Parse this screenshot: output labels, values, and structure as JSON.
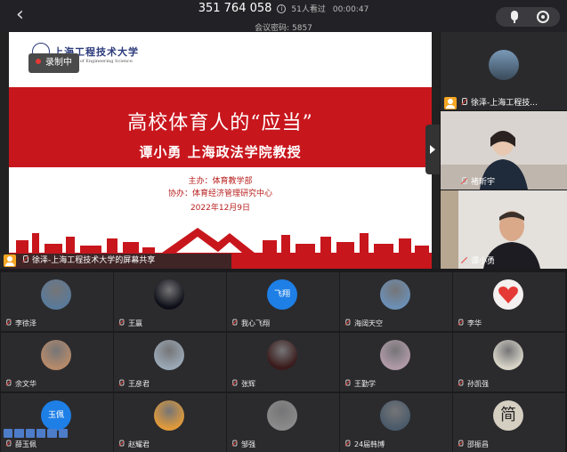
{
  "header": {
    "meeting_id": "351 764 058",
    "participants": "51人看过",
    "elapsed": "00:00:47",
    "password": "会议密码: 5857"
  },
  "share": {
    "recording_label": "录制中",
    "logo_zh": "上海工程技术大学",
    "logo_en": "University of Engineering Science",
    "title": "高校体育人的“应当”",
    "subtitle": "谭小勇  上海政法学院教授",
    "host": "主办：体育教学部",
    "co_host": "协办：体育经济管理研究中心",
    "date": "2022年12月9日",
    "sharer_label": "徐泽-上海工程技术大学的屏幕共享"
  },
  "side_videos": [
    {
      "name": "徐泽-上海工程技..."
    },
    {
      "name": "褚昕宇"
    },
    {
      "name": "谭小勇"
    }
  ],
  "grid": [
    {
      "name": "李徐泽",
      "avatar": "photo-figure",
      "color": "#5a7a9a"
    },
    {
      "name": "王赢",
      "avatar": "photo-dark",
      "color": "#0e0e18"
    },
    {
      "name": "我心飞翔",
      "avatar": "text",
      "text": "飞翔",
      "color": "#1e7fe6"
    },
    {
      "name": "海阔天空",
      "avatar": "photo-person",
      "color": "#6b8fb5"
    },
    {
      "name": "李华",
      "avatar": "heart",
      "color": "#f3f0ef"
    },
    {
      "name": "余文华",
      "avatar": "photo-outdoor",
      "color": "#b68a6a"
    },
    {
      "name": "王彦君",
      "avatar": "photo-street",
      "color": "#9aa8b5"
    },
    {
      "name": "张辉",
      "avatar": "photo-jersey",
      "color": "#3a1a1a"
    },
    {
      "name": "王勤学",
      "avatar": "photo-sunset",
      "color": "#b09aa8"
    },
    {
      "name": "孙凯强",
      "avatar": "photo-beach",
      "color": "#d8d4c8"
    },
    {
      "name": "薛玉佩",
      "avatar": "text",
      "text": "玉佩",
      "color": "#1e7fe6"
    },
    {
      "name": "赵耀君",
      "avatar": "photo-jump",
      "color": "#e09a3a"
    },
    {
      "name": "邹强",
      "avatar": "photo-car",
      "color": "#8a8a8a"
    },
    {
      "name": "24届韩博",
      "avatar": "photo-rock",
      "color": "#4a5a6a"
    },
    {
      "name": "邵振昌",
      "avatar": "glyph",
      "text": "简",
      "color": "#d5cfc2"
    }
  ]
}
